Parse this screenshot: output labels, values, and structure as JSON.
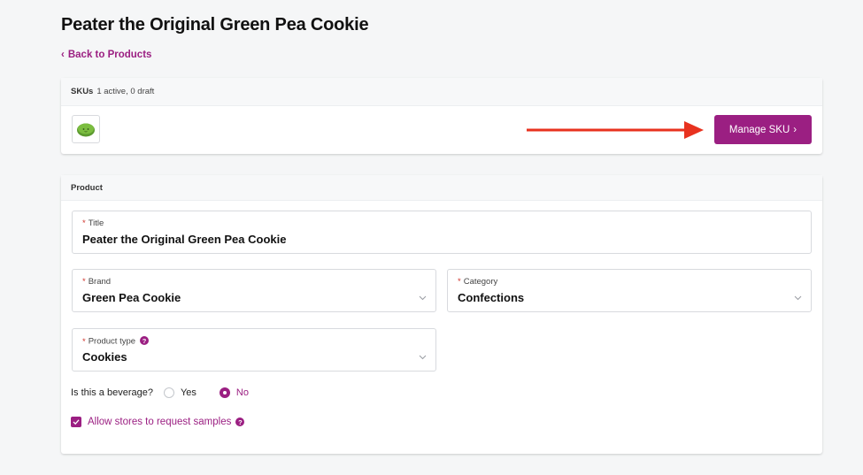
{
  "page": {
    "title": "Peater the Original Green Pea Cookie"
  },
  "nav": {
    "back_label": "Back to Products"
  },
  "skus": {
    "heading": "SKUs",
    "summary": "1 active, 0 draft",
    "thumbnail": "green-pea-cookie-thumbnail",
    "manage_label": "Manage SKU"
  },
  "product": {
    "heading": "Product",
    "title_field": {
      "label": "Title",
      "value": "Peater the Original Green Pea Cookie"
    },
    "brand_field": {
      "label": "Brand",
      "value": "Green Pea Cookie"
    },
    "category_field": {
      "label": "Category",
      "value": "Confections"
    },
    "product_type_field": {
      "label": "Product type",
      "value": "Cookies"
    },
    "beverage": {
      "question": "Is this a beverage?",
      "options": [
        "Yes",
        "No"
      ],
      "selected": "No"
    },
    "samples": {
      "label": "Allow stores to request samples",
      "checked": true
    }
  },
  "colors": {
    "accent": "#9b1f82",
    "arrow": "#e8321f",
    "required": "#d0342c"
  },
  "icons": {
    "help": "question-mark-icon",
    "dropdown": "chevron-down-icon",
    "back": "chevron-left-icon",
    "forward": "chevron-right-icon"
  }
}
